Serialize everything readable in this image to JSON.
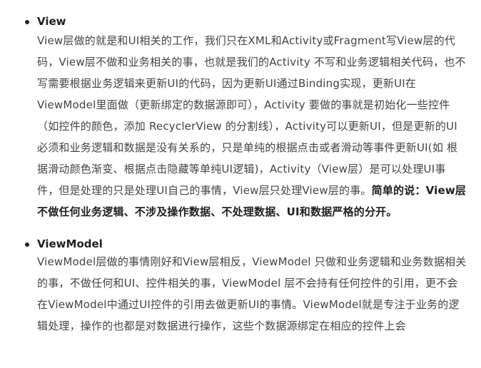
{
  "sections": [
    {
      "title": "View",
      "body": "View层做的就是和UI相关的工作，我们只在XML和Activity或Fragment写View层的代码，View层不做和业务相关的事，也就是我们的Activity 不写和业务逻辑相关代码，也不写需要根据业务逻辑来更新UI的代码，因为更新UI通过Binding实现，更新UI在ViewModel里面做（更新绑定的数据源即可），Activity 要做的事就是初始化一些控件（如控件的颜色，添加 RecyclerView 的分割线），Activity可以更新UI，但是更新的UI必须和业务逻辑和数据是没有关系的，只是单纯的根据点击或者滑动等事件更新UI(如 根据滑动颜色渐变、根据点击隐藏等单纯UI逻辑)，Activity（View层）是可以处理UI事件，但是处理的只是处理UI自己的事情，View层只处理View层的事。",
      "emphasis": "简单的说：View层不做任何业务逻辑、不涉及操作数据、不处理数据、UI和数据严格的分开。"
    },
    {
      "title": "ViewModel",
      "body": "ViewModel层做的事情刚好和View层相反，ViewModel 只做和业务逻辑和业务数据相关的事，不做任何和UI、控件相关的事，ViewModel 层不会持有任何控件的引用，更不会在ViewModel中通过UI控件的引用去做更新UI的事情。ViewModel就是专注于业务的逻辑处理，操作的也都是对数据进行操作，这些个数据源绑定在相应的控件上会"
    }
  ]
}
